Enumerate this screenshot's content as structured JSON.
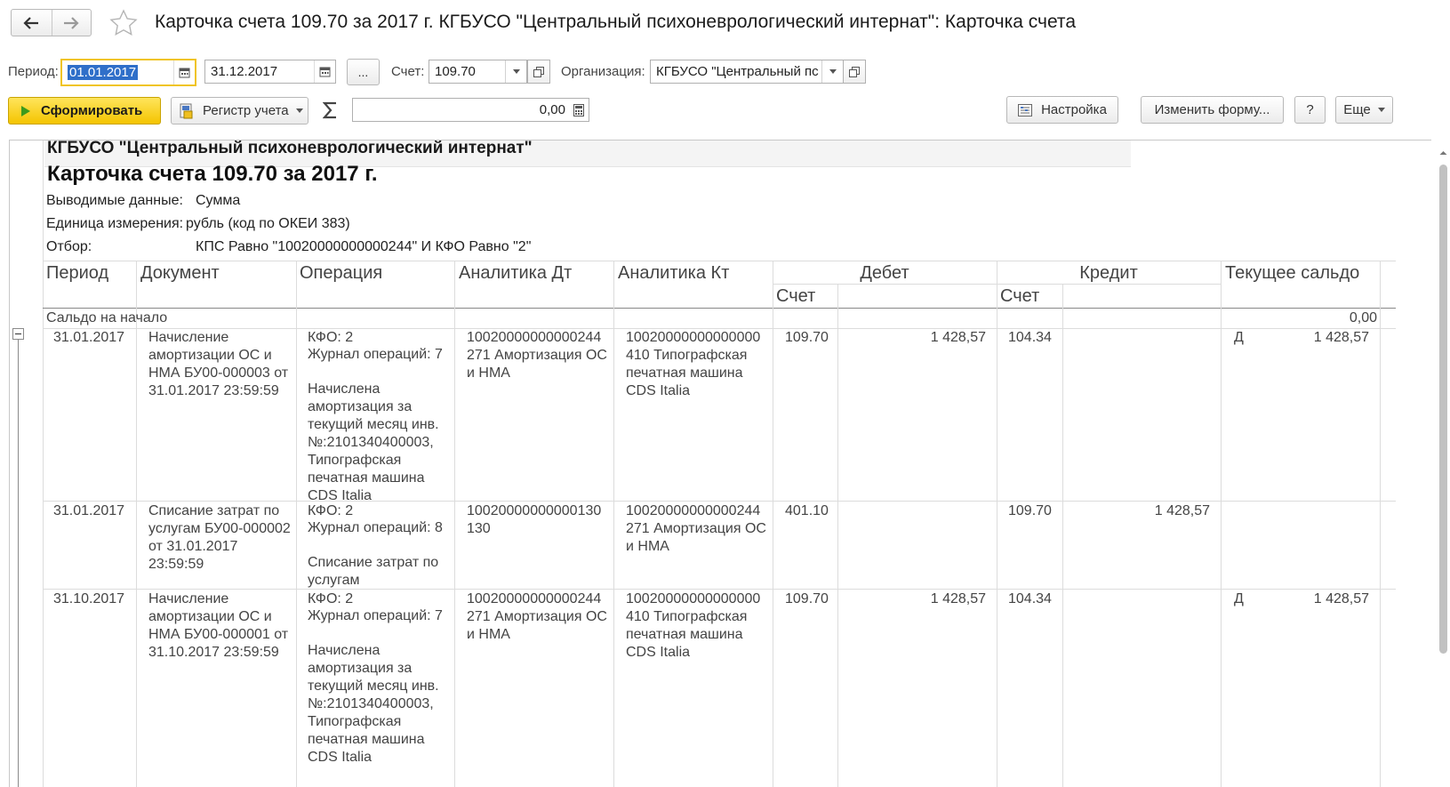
{
  "window": {
    "title": "Карточка счета 109.70 за 2017 г. КГБУСО \"Центральный психоневрологический интернат\": Карточка счета"
  },
  "params": {
    "period_label": "Период:",
    "date_from": "01.01.2017",
    "date_to": "31.12.2017",
    "ellipsis_label": "...",
    "account_label": "Счет:",
    "account_value": "109.70",
    "org_label": "Организация:",
    "org_value": "КГБУСО \"Центральный пс"
  },
  "toolbar": {
    "generate_label": "Сформировать",
    "register_label": "Регистр учета",
    "sum_value": "0,00",
    "settings_label": "Настройка",
    "change_form_label": "Изменить форму...",
    "help_label": "?",
    "more_label": "Еще"
  },
  "report": {
    "org_name": "КГБУСО \"Центральный психоневрологический интернат\"",
    "title": "Карточка счета 109.70 за 2017 г.",
    "output_label": "Выводимые данные:",
    "output_value": "Сумма",
    "unit_label": "Единица измерения:",
    "unit_value": "рубль (код по ОКЕИ 383)",
    "filter_label": "Отбор:",
    "filter_value": "КПС Равно \"10020000000000244\" И КФО Равно \"2\"",
    "columns": {
      "period": "Период",
      "document": "Документ",
      "operation": "Операция",
      "analytics_dt": "Аналитика Дт",
      "analytics_kt": "Аналитика Кт",
      "debit": "Дебет",
      "credit": "Кредит",
      "balance": "Текущее сальдо",
      "debit_account": "Счет",
      "credit_account": "Счет"
    },
    "opening_label": "Сальдо на начало",
    "opening_value": "0,00",
    "rows": [
      {
        "period": "31.01.2017",
        "document": "Начисление амортизации ОС и НМА БУ00-000003 от 31.01.2017 23:59:59",
        "operation_kfo": "КФО: 2",
        "operation_journal": "Журнал операций: 7",
        "operation_desc": "Начислена амортизация за текущий месяц инв. №:2101340400003, Типографская печатная машина CDS Italia",
        "analytics_dt": "10020000000000244 271 Амортизация ОС и НМА",
        "analytics_kt": "10020000000000000 410 Типографская печатная машина CDS Italia",
        "debit_account": "109.70",
        "debit_amount": "1 428,57",
        "credit_account": "104.34",
        "credit_amount": "",
        "balance_side": "Д",
        "balance_amount": "1 428,57"
      },
      {
        "period": "31.01.2017",
        "document": "Списание затрат по услугам БУ00-000002 от 31.01.2017 23:59:59",
        "operation_kfo": "КФО: 2",
        "operation_journal": "Журнал операций: 8",
        "operation_desc": "Списание затрат по услугам",
        "analytics_dt": "10020000000000130 130",
        "analytics_kt": "10020000000000244 271 Амортизация ОС и НМА",
        "debit_account": "401.10",
        "debit_amount": "",
        "credit_account": "109.70",
        "credit_amount": "1 428,57",
        "balance_side": "",
        "balance_amount": ""
      },
      {
        "period": "31.10.2017",
        "document": "Начисление амортизации ОС и НМА БУ00-000001 от 31.10.2017 23:59:59",
        "operation_kfo": "КФО: 2",
        "operation_journal": "Журнал операций: 7",
        "operation_desc": "Начислена амортизация за текущий месяц инв. №:2101340400003, Типографская печатная машина CDS Italia",
        "analytics_dt": "10020000000000244 271 Амортизация ОС и НМА",
        "analytics_kt": "10020000000000000 410 Типографская печатная машина CDS Italia",
        "debit_account": "109.70",
        "debit_amount": "1 428,57",
        "credit_account": "104.34",
        "credit_amount": "",
        "balance_side": "Д",
        "balance_amount": "1 428,57"
      }
    ]
  },
  "colors": {
    "primary_button": "#f4c400",
    "focus_border": "#f0c420",
    "selection": "#2f6fc9",
    "grid_line": "#dcdcdc"
  },
  "icons": {
    "back": "arrow-left-icon",
    "forward": "arrow-right-icon",
    "favorite": "star-icon",
    "calendar": "calendar-icon",
    "dropdown": "chevron-down-icon",
    "open": "open-window-icon",
    "play": "play-icon",
    "register": "register-icon",
    "sum": "sigma-icon",
    "calculator": "calculator-icon",
    "settings": "settings-icon",
    "collapse": "minus-box-icon"
  }
}
